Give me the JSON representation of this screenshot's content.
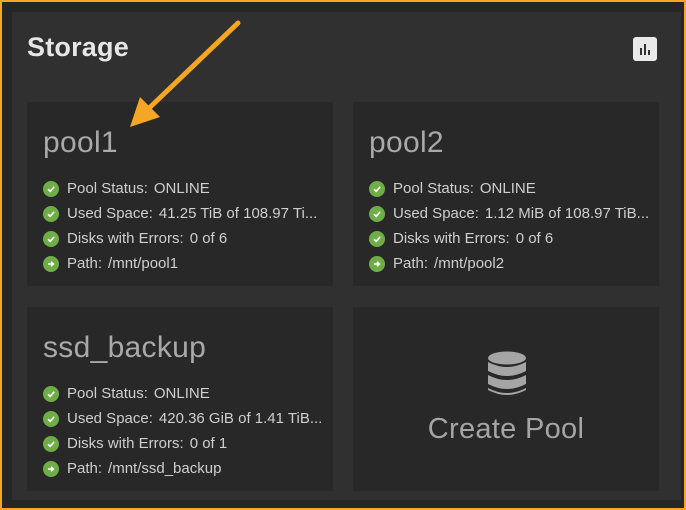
{
  "widget": {
    "title": "Storage",
    "chart_icon": "bar-chart-icon"
  },
  "pools": [
    {
      "name": "pool1",
      "rows": [
        {
          "icon": "check-circle-icon",
          "label": "Pool Status:",
          "value": "ONLINE"
        },
        {
          "icon": "check-circle-icon",
          "label": "Used Space:",
          "value": "41.25 TiB of 108.97 Ti..."
        },
        {
          "icon": "check-circle-icon",
          "label": "Disks with Errors:",
          "value": "0 of 6"
        },
        {
          "icon": "arrow-right-circle-icon",
          "label": "Path:",
          "value": "/mnt/pool1"
        }
      ]
    },
    {
      "name": "pool2",
      "rows": [
        {
          "icon": "check-circle-icon",
          "label": "Pool Status:",
          "value": "ONLINE"
        },
        {
          "icon": "check-circle-icon",
          "label": "Used Space:",
          "value": "1.12 MiB of 108.97 TiB..."
        },
        {
          "icon": "check-circle-icon",
          "label": "Disks with Errors:",
          "value": "0 of 6"
        },
        {
          "icon": "arrow-right-circle-icon",
          "label": "Path:",
          "value": "/mnt/pool2"
        }
      ]
    },
    {
      "name": "ssd_backup",
      "rows": [
        {
          "icon": "check-circle-icon",
          "label": "Pool Status:",
          "value": "ONLINE"
        },
        {
          "icon": "check-circle-icon",
          "label": "Used Space:",
          "value": "420.36 GiB of 1.41 TiB..."
        },
        {
          "icon": "check-circle-icon",
          "label": "Disks with Errors:",
          "value": "0 of 1"
        },
        {
          "icon": "arrow-right-circle-icon",
          "label": "Path:",
          "value": "/mnt/ssd_backup"
        }
      ]
    }
  ],
  "create_pool": {
    "label": "Create Pool",
    "icon": "database-icon"
  },
  "colors": {
    "accent": "#f5a623",
    "ok": "#6fae47"
  }
}
